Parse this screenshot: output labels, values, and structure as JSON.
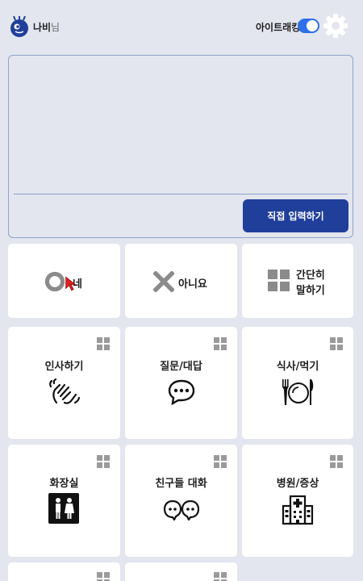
{
  "header": {
    "user_name": "나비",
    "user_suffix": "님",
    "eye_tracking_label": "아이트래킹",
    "eye_tracking_on": true,
    "accent_color": "#2f6fe8"
  },
  "input_panel": {
    "submit_label": "직접 입력하기",
    "button_color": "#203f9b"
  },
  "quick": {
    "yes_label": "네",
    "no_label": "아니요",
    "simple_line1": "간단히",
    "simple_line2": "말하기"
  },
  "categories": [
    {
      "label": "인사하기",
      "icon": "waving-hands-icon"
    },
    {
      "label": "질문/대답",
      "icon": "speech-bubble-icon"
    },
    {
      "label": "식사/먹기",
      "icon": "plate-fork-knife-icon"
    },
    {
      "label": "화장실",
      "icon": "restroom-icon"
    },
    {
      "label": "친구들 대화",
      "icon": "friends-chat-icon"
    },
    {
      "label": "병원/증상",
      "icon": "hospital-icon"
    }
  ]
}
